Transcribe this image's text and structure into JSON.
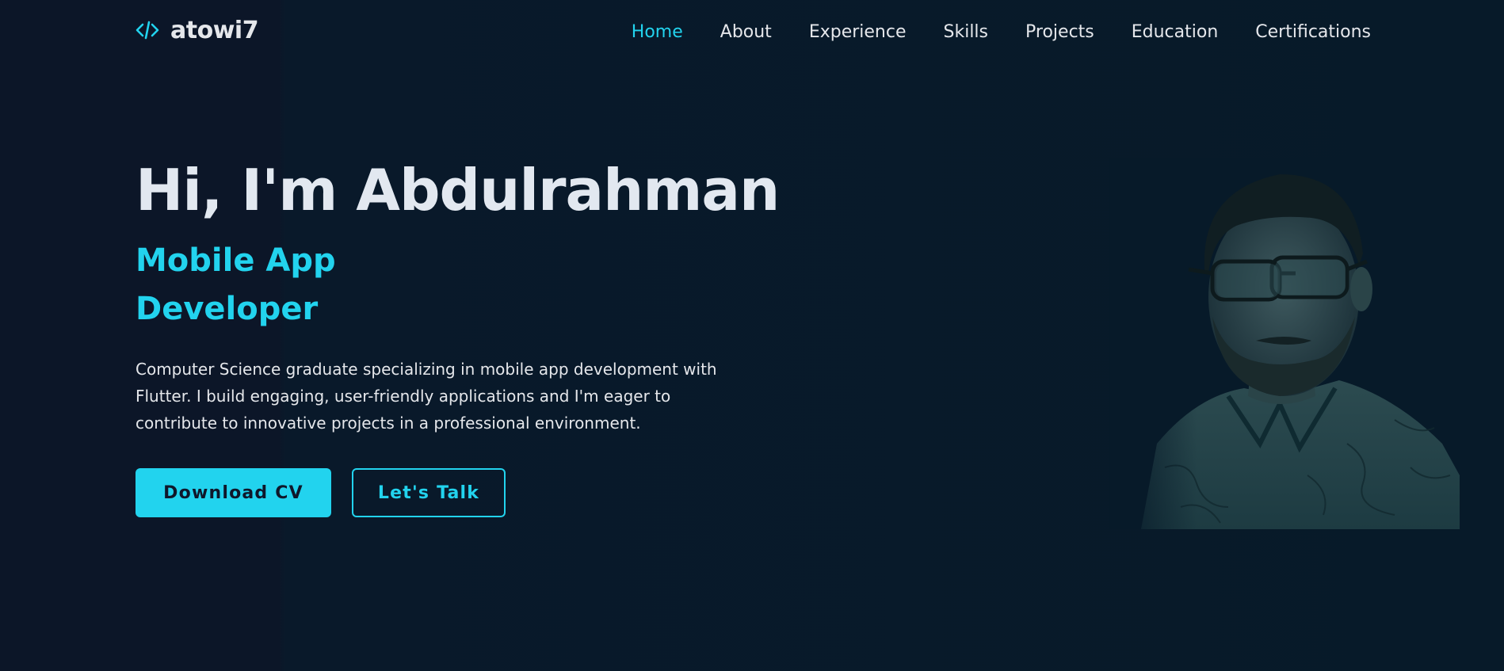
{
  "nav": {
    "logo_icon": "code-icon",
    "logo_text": "atowi7",
    "links": [
      {
        "label": "Home",
        "active": true
      },
      {
        "label": "About",
        "active": false
      },
      {
        "label": "Experience",
        "active": false
      },
      {
        "label": "Skills",
        "active": false
      },
      {
        "label": "Projects",
        "active": false
      },
      {
        "label": "Education",
        "active": false
      },
      {
        "label": "Certifications",
        "active": false
      }
    ]
  },
  "hero": {
    "greeting": "Hi, I'm Abdulrahman",
    "role": "Mobile App Developer",
    "description": "Computer Science graduate specializing in mobile app development with Flutter. I build engaging, user-friendly applications and I'm eager to contribute to innovative projects in a professional environment.",
    "primary_button": "Download CV",
    "secondary_button": "Let's Talk"
  },
  "colors": {
    "accent": "#22d3ee",
    "background": "#071a29",
    "text": "#e2e8f0"
  }
}
